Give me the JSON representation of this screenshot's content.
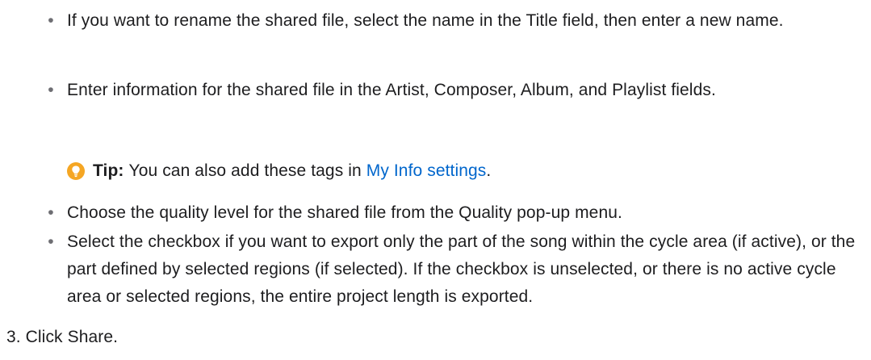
{
  "bullets": [
    {
      "dot": "•",
      "text": "If you want to rename the shared file, select the name in the Title field, then enter a new name."
    },
    {
      "dot": "•",
      "text": "Enter information for the shared file in the Artist, Composer, Album, and Playlist fields."
    },
    {
      "dot": "•",
      "text": "Choose the quality level for the shared file from the Quality pop-up menu."
    },
    {
      "dot": "•",
      "text": "Select the checkbox if you want to export only the part of the song within the cycle area (if active), or the part defined by selected regions (if selected). If the checkbox is unselected, or there is no active cycle area or selected regions, the entire project length is exported."
    }
  ],
  "tip": {
    "icon": "lightbulb-icon",
    "label": "Tip:",
    "text": "You can also add these tags in",
    "link": "My Info settings",
    "suffix": "."
  },
  "step": {
    "number": "3.",
    "text": "Click Share."
  },
  "colors": {
    "text": "#1d1d1f",
    "link": "#0066cc",
    "tip_icon": "#f5a623"
  }
}
